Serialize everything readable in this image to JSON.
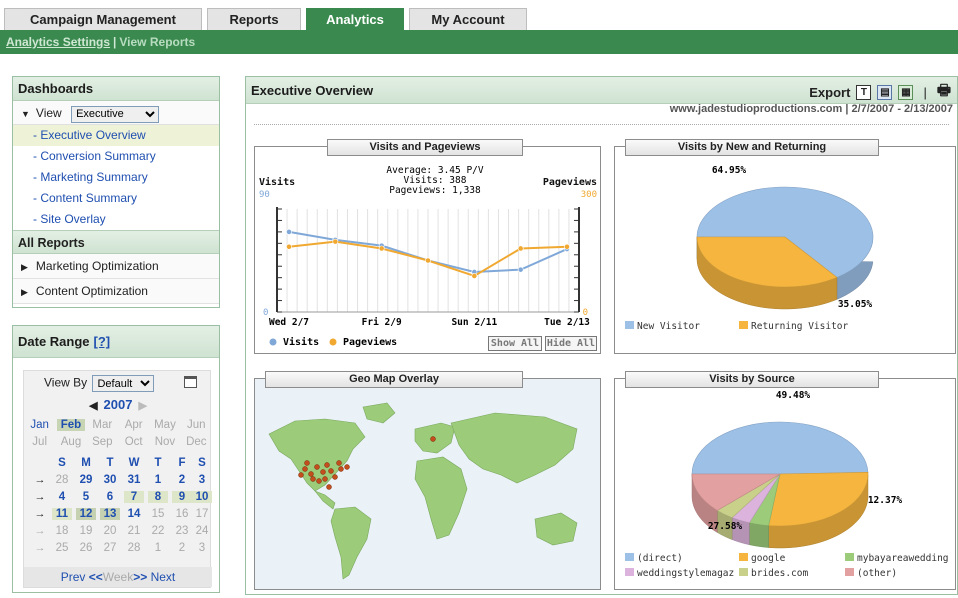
{
  "tabs": [
    {
      "label": "Campaign Management"
    },
    {
      "label": "Reports"
    },
    {
      "label": "Analytics"
    },
    {
      "label": "My Account"
    }
  ],
  "subnav": {
    "settings": "Analytics Settings",
    "sep": "|",
    "view_reports": "View Reports"
  },
  "dashboards": {
    "title": "Dashboards",
    "view_label": "View",
    "view_select": "Executive",
    "items": [
      {
        "label": "- Executive Overview"
      },
      {
        "label": "- Conversion Summary"
      },
      {
        "label": "- Marketing Summary"
      },
      {
        "label": "- Content Summary"
      },
      {
        "label": "- Site Overlay"
      }
    ],
    "all_reports": "All Reports",
    "reports": [
      {
        "label": "Marketing Optimization"
      },
      {
        "label": "Content Optimization"
      }
    ]
  },
  "date_range": {
    "title": "Date Range",
    "help": "[?]",
    "view_by_label": "View By",
    "view_by_value": "Default",
    "year": "2007",
    "months_row1": [
      "Jan",
      "Feb",
      "Mar",
      "Apr",
      "May",
      "Jun"
    ],
    "months_row2": [
      "Jul",
      "Aug",
      "Sep",
      "Oct",
      "Nov",
      "Dec"
    ],
    "weekdays": [
      "S",
      "M",
      "T",
      "W",
      "T",
      "F",
      "S"
    ],
    "weeks": [
      [
        "28",
        "29",
        "30",
        "31",
        "1",
        "2",
        "3"
      ],
      [
        "4",
        "5",
        "6",
        "7",
        "8",
        "9",
        "10"
      ],
      [
        "11",
        "12",
        "13",
        "14",
        "15",
        "16",
        "17"
      ],
      [
        "18",
        "19",
        "20",
        "21",
        "22",
        "23",
        "24"
      ],
      [
        "25",
        "26",
        "27",
        "28",
        "1",
        "2",
        "3"
      ]
    ],
    "prev": "Prev",
    "prev_arrows": "<<",
    "week": "Week",
    "next_arrows": ">>",
    "next": "Next"
  },
  "main": {
    "title": "Executive Overview",
    "export_label": "Export",
    "export_t": "T",
    "site": "www.jadestudioproductions.com  |  2/7/2007 - 2/13/2007"
  },
  "visits_chart": {
    "title": "Visits and Pageviews",
    "stats": [
      "Average: 3.45 P/V",
      "Visits: 388",
      "Pageviews: 1,338"
    ],
    "left_label": "Visits",
    "left_max": "90",
    "left_min": "0",
    "right_label": "Pageviews",
    "right_max": "300",
    "right_min": "0",
    "legend_visits": "Visits",
    "legend_pageviews": "Pageviews",
    "show_all": "Show All",
    "hide_all": "Hide All",
    "colors": {
      "visits": "#7fa8d8",
      "pageviews": "#f0a830"
    }
  },
  "chart_data": [
    {
      "type": "line",
      "title": "Visits and Pageviews",
      "x": [
        "Wed 2/7",
        "Thu 2/8",
        "Fri 2/9",
        "Sat 2/10",
        "Sun 2/11",
        "Mon 2/12",
        "Tue 2/13"
      ],
      "x_tick_labels": [
        "Wed 2/7",
        "Fri 2/9",
        "Sun 2/11",
        "Tue 2/13"
      ],
      "series": [
        {
          "name": "Visits",
          "axis": "left",
          "values": [
            70,
            63,
            58,
            45,
            35,
            37,
            55
          ]
        },
        {
          "name": "Pageviews",
          "axis": "right",
          "values": [
            190,
            205,
            185,
            150,
            105,
            185,
            190
          ]
        }
      ],
      "ylim_left": [
        0,
        90
      ],
      "ylim_right": [
        0,
        300
      ],
      "grid": true
    },
    {
      "type": "pie",
      "title": "Visits by New and Returning",
      "labels": [
        "New Visitor",
        "Returning Visitor"
      ],
      "values": [
        64.95,
        35.05
      ],
      "value_labels": [
        "64.95%",
        "35.05%"
      ],
      "colors": [
        "#9dc0e6",
        "#f5b53f"
      ]
    },
    {
      "type": "pie",
      "title": "Visits by Source",
      "labels": [
        "(direct)",
        "google",
        "mybayareawedding",
        "weddingstylemagaz",
        "brides.com",
        "(other)"
      ],
      "values": [
        49.48,
        27.58,
        3.6,
        3.5,
        3.47,
        12.37
      ],
      "value_labels": [
        "49.48%",
        "27.58%",
        "12.37%"
      ],
      "colors": [
        "#9dc0e6",
        "#f5b53f",
        "#9ccc7a",
        "#dcb3dc",
        "#c9d08a",
        "#e3a0a0"
      ]
    }
  ],
  "geo": {
    "title": "Geo Map Overlay"
  }
}
